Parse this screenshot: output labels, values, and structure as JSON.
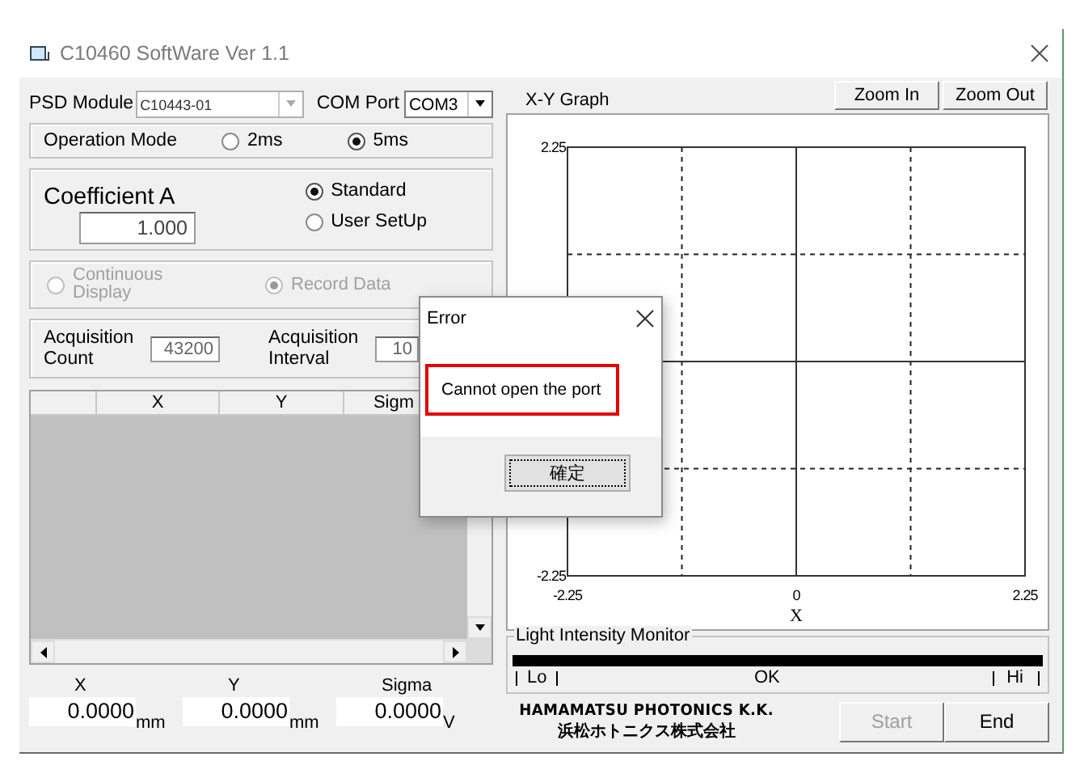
{
  "window": {
    "title": "C10460 SoftWare Ver 1.1"
  },
  "psd_module": {
    "label": "PSD Module",
    "value": "C10443-01",
    "disabled": true
  },
  "com_port": {
    "label": "COM Port",
    "value": "COM3",
    "disabled": false
  },
  "operation_mode": {
    "label": "Operation Mode",
    "options": [
      {
        "label": "2ms",
        "selected": false
      },
      {
        "label": "5ms",
        "selected": true
      }
    ]
  },
  "coefficient": {
    "label": "Coefficient A",
    "value": "1.000",
    "options": [
      {
        "label": "Standard",
        "selected": true
      },
      {
        "label": "User SetUp",
        "selected": false
      }
    ]
  },
  "display_mode": {
    "disabled": true,
    "options": [
      {
        "label": "Continuous Display",
        "selected": false
      },
      {
        "label": "Record Data",
        "selected": true
      }
    ]
  },
  "acquisition": [
    {
      "label": "Acquisition Count",
      "value": "43200"
    },
    {
      "label": "Acquisition Interval",
      "value": "10"
    }
  ],
  "table": {
    "columns": [
      "X",
      "Y",
      "Sigm"
    ]
  },
  "readouts": [
    {
      "label": "X",
      "value": "0.0000",
      "unit": "mm"
    },
    {
      "label": "Y",
      "value": "0.0000",
      "unit": "mm"
    },
    {
      "label": "Sigma",
      "value": "0.0000",
      "unit": "V"
    }
  ],
  "graph": {
    "title": "X-Y Graph",
    "buttons": [
      {
        "label": "Zoom In",
        "disabled": false
      },
      {
        "label": "Zoom Out",
        "disabled": false
      }
    ],
    "chart_data": {
      "type": "scatter",
      "xlabel": "X",
      "xlim": [
        -2.25,
        2.25
      ],
      "ylim": [
        -2.25,
        2.25
      ],
      "xticks": [
        -2.25,
        0,
        2.25
      ],
      "yticks": [
        -2.25,
        2.25
      ]
    }
  },
  "light_monitor": {
    "title": "Light Intensity Monitor",
    "level": 1,
    "labels": [
      "Lo",
      "OK",
      "Hi"
    ]
  },
  "logo": {
    "name": "HAMAMATSU PHOTONICS K.K.",
    "name_ja": "浜松ホトニクス株式会社"
  },
  "buttons": [
    {
      "label": "Start",
      "disabled": true
    },
    {
      "label": "End",
      "disabled": false
    }
  ],
  "dialog": {
    "title": "Error",
    "message": "Cannot open the port",
    "highlighted": true,
    "button": "確定"
  }
}
